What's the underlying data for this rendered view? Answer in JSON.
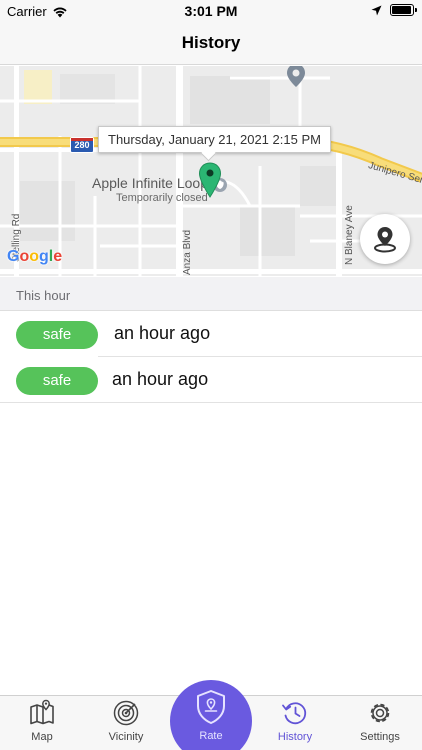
{
  "status_bar": {
    "carrier": "Carrier",
    "time": "3:01 PM",
    "battery_level": 0.95
  },
  "nav": {
    "title": "History"
  },
  "map": {
    "tooltip": "Thursday, January 21, 2021 2:15 PM",
    "poi_name": "Apple Infinite Loop",
    "poi_subtitle": "Temporarily closed",
    "highway_number": "280",
    "road_labels": {
      "junipero": "Junipero Serra",
      "stelling": "Stelling Rd",
      "anza": "Anza Blvd",
      "blaney": "N Blaney Ave"
    },
    "logo_letters": [
      "G",
      "o",
      "o",
      "g",
      "l",
      "e"
    ],
    "marker_color": "#2bb673"
  },
  "section": {
    "title": "This hour"
  },
  "history": [
    {
      "status": "safe",
      "time": "an hour ago"
    },
    {
      "status": "safe",
      "time": "an hour ago"
    }
  ],
  "tabs": [
    {
      "label": "Map",
      "icon": "map-icon"
    },
    {
      "label": "Vicinity",
      "icon": "radar-icon"
    },
    {
      "label": "Rate",
      "icon": "shield-icon"
    },
    {
      "label": "History",
      "icon": "history-icon",
      "active": true
    },
    {
      "label": "Settings",
      "icon": "gear-icon"
    }
  ],
  "colors": {
    "accent": "#6a5ae0",
    "active_tab": "#6153d6",
    "safe": "#56c35a"
  }
}
